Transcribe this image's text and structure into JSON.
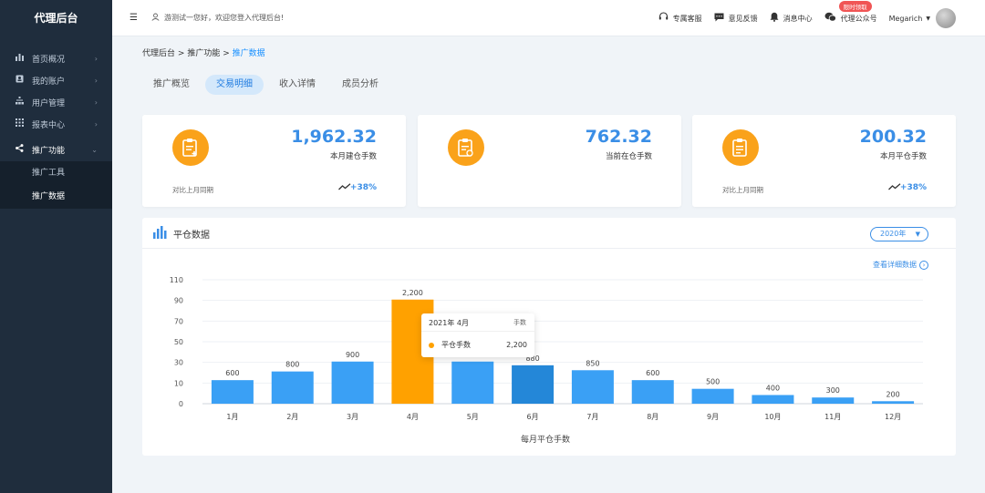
{
  "brand": "代理后台",
  "sidebar": {
    "items": [
      {
        "label": "首页概况",
        "icon": "bar-chart-icon"
      },
      {
        "label": "我的账户",
        "icon": "account-icon"
      },
      {
        "label": "用户管理",
        "icon": "org-icon"
      },
      {
        "label": "报表中心",
        "icon": "grid-icon"
      },
      {
        "label": "推广功能",
        "icon": "share-icon"
      }
    ],
    "sub": [
      "推广工具",
      "推广数据"
    ]
  },
  "header": {
    "welcome": "游测试一您好，欢迎您登入代理后台!",
    "service": "专属客服",
    "feedback": "意见反馈",
    "messages": "消息中心",
    "wechat": "代理公众号",
    "badge": "限时领取",
    "user": "Megarich"
  },
  "breadcrumb": {
    "a": "代理后台",
    "b": "推广功能",
    "c": "推广数据",
    "sep": ">"
  },
  "tabs": [
    "推广概览",
    "交易明细",
    "收入详情",
    "成员分析"
  ],
  "cards": [
    {
      "value": "1,962.32",
      "label": "本月建仓手数",
      "compare": "对比上月同期",
      "pct": "+38%"
    },
    {
      "value": "762.32",
      "label": "当前在仓手数"
    },
    {
      "value": "200.32",
      "label": "本月平仓手数",
      "compare": "对比上月同期",
      "pct": "+38%"
    }
  ],
  "panel": {
    "title": "平仓数据",
    "year": "2020年",
    "detail": "查看详细数据"
  },
  "tooltip": {
    "header": "2021年 4月",
    "unit": "手数",
    "series": "平仓手数",
    "value": "2,200"
  },
  "chart_data": {
    "type": "bar",
    "xlabel": "每月平仓手数",
    "ylabel": "",
    "yticks": [
      "0",
      "10",
      "30",
      "50",
      "70",
      "90",
      "110"
    ],
    "categories": [
      "1月",
      "2月",
      "3月",
      "4月",
      "5月",
      "6月",
      "7月",
      "8月",
      "9月",
      "10月",
      "11月",
      "12月"
    ],
    "values": [
      600,
      800,
      900,
      2200,
      900,
      880,
      850,
      600,
      500,
      400,
      300,
      200
    ],
    "labels": [
      "600",
      "800",
      "900",
      "2,200",
      "900",
      "880",
      "850",
      "600",
      "500",
      "400",
      "300",
      "200"
    ],
    "bar_levels": [
      19,
      26,
      34,
      84,
      34,
      31,
      27,
      19,
      12,
      7,
      5,
      2
    ],
    "highlight_index": 3,
    "hover_index": 5,
    "colors": {
      "bar": "#3aa0f5",
      "highlight": "#ffa100",
      "hover": "#2487d8"
    }
  }
}
